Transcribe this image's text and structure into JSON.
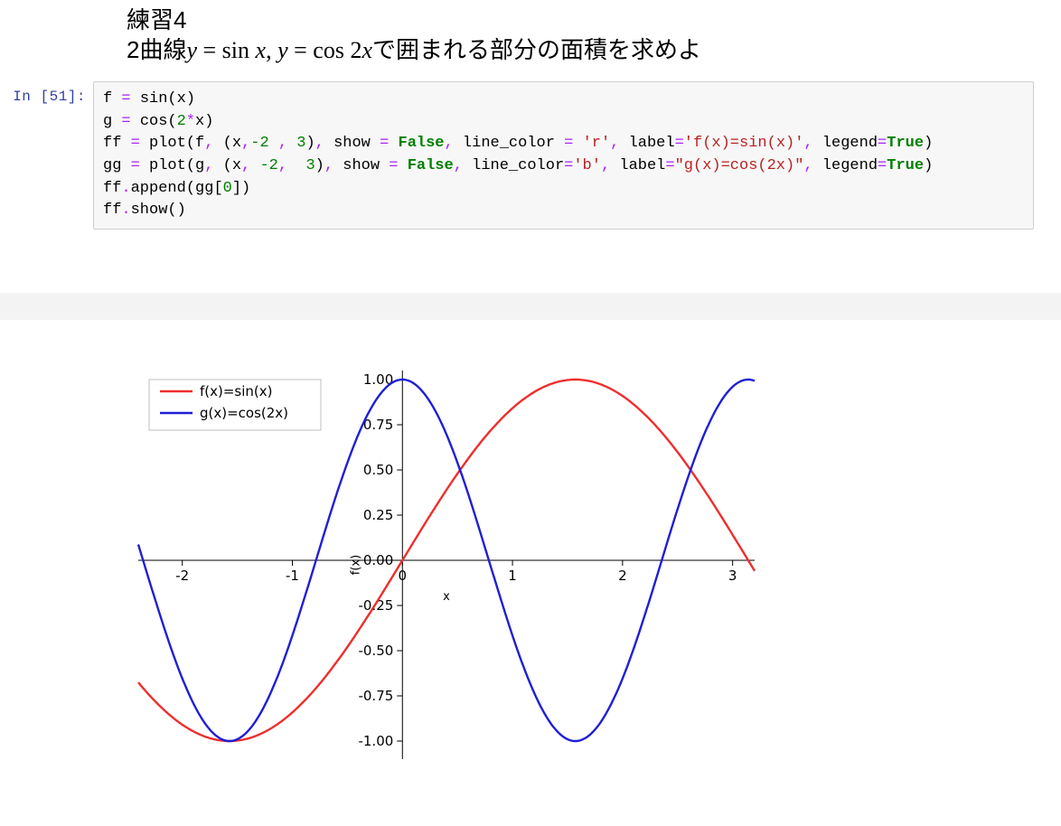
{
  "problem": {
    "title": "練習4",
    "prefix": "2曲線",
    "eq1_lhs": "y",
    "eq1_op": " = sin ",
    "eq1_rhs": "x",
    "sep": ",  ",
    "eq2_lhs": "y",
    "eq2_op": " = cos 2",
    "eq2_rhs": "x",
    "suffix": "で囲まれる部分の面積を求めよ"
  },
  "cell": {
    "prompt": "In [51]:",
    "code_plain": "f = sin(x)\ng = cos(2*x)\nff = plot(f, (x,-2 , 3), show = False, line_color = 'r', label='f(x)=sin(x)', legend=True)\ngg = plot(g, (x, -2,  3), show = False, line_color='b', label=\"g(x)=cos(2x)\", legend=True)\nff.append(gg[0])\nff.show()"
  },
  "chart_data": {
    "type": "line",
    "xlabel": "x",
    "ylabel": "f(x)",
    "xlim": [
      -2.4,
      3.2
    ],
    "ylim": [
      -1.1,
      1.05
    ],
    "xticks": [
      -2,
      -1,
      0,
      1,
      2,
      3
    ],
    "yticks": [
      -1.0,
      -0.75,
      -0.5,
      -0.25,
      0.0,
      0.25,
      0.5,
      0.75,
      1.0
    ],
    "series": [
      {
        "name": "f(x)=sin(x)",
        "color": "#e24a33",
        "func": "sin(x)"
      },
      {
        "name": "g(x)=cos(2x)",
        "color": "#348abd",
        "func": "cos(2x)"
      }
    ],
    "legend_position": "upper-left"
  },
  "colors": {
    "series1": "#ef2e2e",
    "series2": "#1f1fd6",
    "grid": "#b0b0b0"
  }
}
